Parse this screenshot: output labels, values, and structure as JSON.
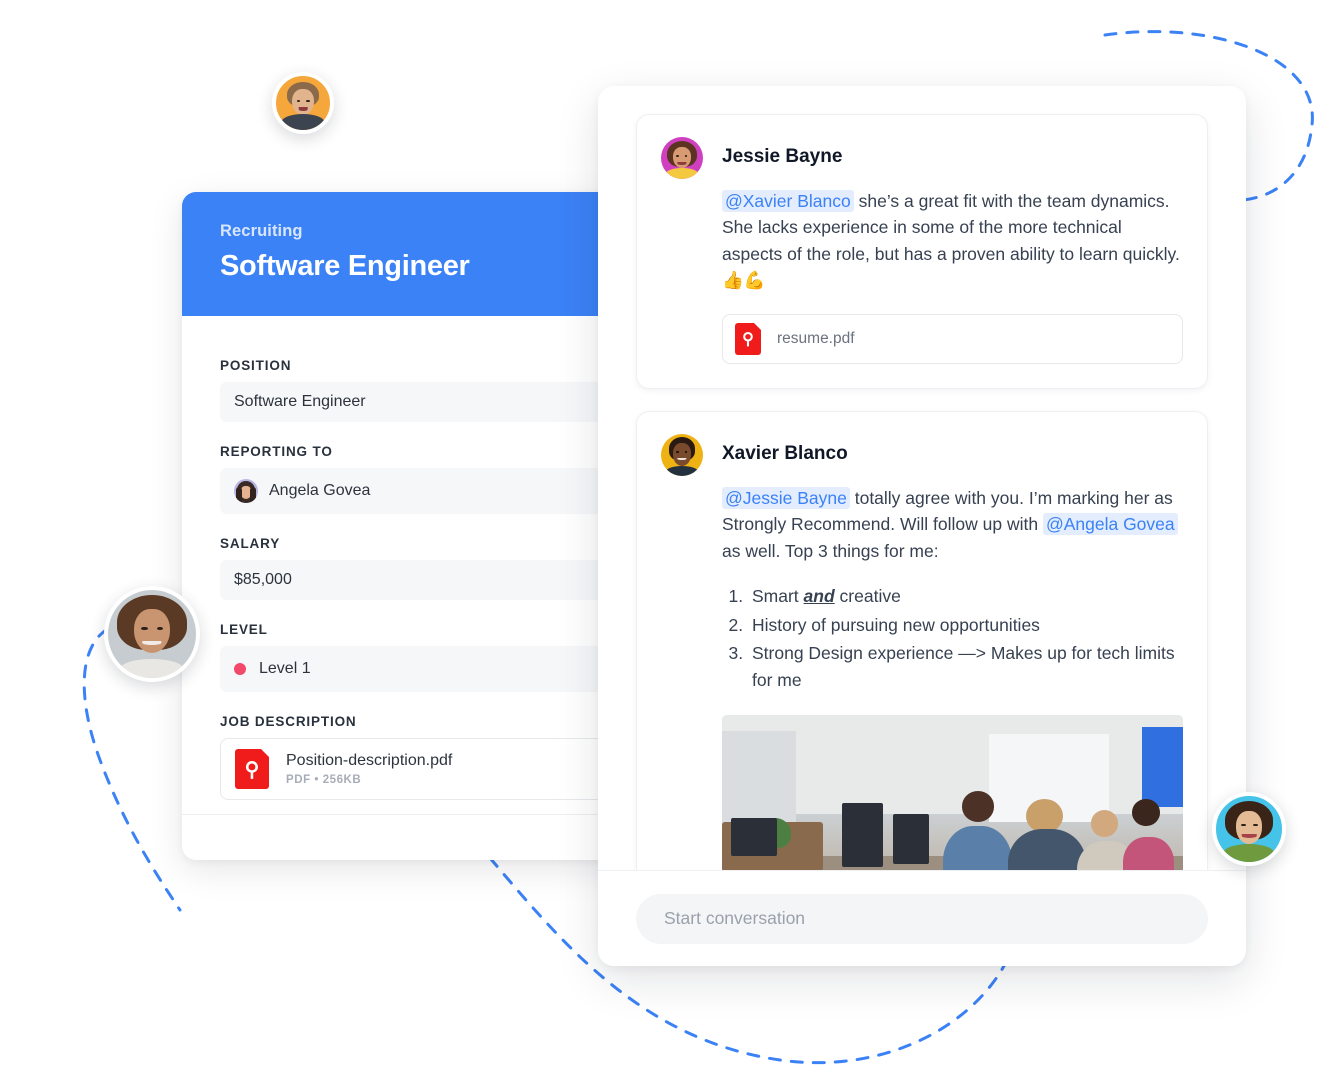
{
  "colors": {
    "brand_blue": "#3b82f6",
    "mention_blue": "#3b82f6",
    "mention_bg": "#e3edfd",
    "level_dot": "#f2486a",
    "pdf_red": "#f01c1c",
    "dashed_line": "#3b82f6"
  },
  "job_card": {
    "eyebrow": "Recruiting",
    "title": "Software Engineer",
    "fields": [
      {
        "label": "POSITION",
        "value": "Software Engineer",
        "type": "text"
      },
      {
        "label": "REPORTING TO",
        "value": "Angela Govea",
        "type": "person"
      },
      {
        "label": "SALARY",
        "value": "$85,000",
        "type": "text"
      },
      {
        "label": "LEVEL",
        "value": "Level 1",
        "type": "pill"
      }
    ],
    "attachment_label": "JOB DESCRIPTION",
    "attachment": {
      "name": "Position-description.pdf",
      "meta": "PDF • 256KB",
      "icon": "pdf-icon"
    }
  },
  "conversation": {
    "messages": [
      {
        "author": "Jessie Bayne",
        "avatar": "jessie-avatar",
        "text_parts": [
          {
            "type": "mention",
            "text": "@Xavier Blanco"
          },
          {
            "type": "plain",
            "text": " she’s a great fit with the team dynamics. She lacks experience in some of the more technical aspects of the role, but has a proven ability to learn quickly. 👍💪"
          }
        ],
        "attachment": {
          "name": "resume.pdf",
          "icon": "pdf-icon"
        }
      },
      {
        "author": "Xavier Blanco",
        "avatar": "xavier-avatar",
        "text_parts": [
          {
            "type": "mention",
            "text": "@Jessie Bayne"
          },
          {
            "type": "plain",
            "text": " totally agree with you. I’m marking her as Strongly Recommend. Will follow up with "
          },
          {
            "type": "mention",
            "text": "@Angela Govea"
          },
          {
            "type": "plain",
            "text": " as well. Top 3 things for me:"
          }
        ],
        "list": [
          {
            "pre": "Smart ",
            "emphasis": "and",
            "post": " creative"
          },
          {
            "pre": "History of pursuing new opportunities",
            "emphasis": "",
            "post": ""
          },
          {
            "pre": "Strong Design experience —> Makes up for tech limits for me",
            "emphasis": "",
            "post": ""
          }
        ],
        "photo": "office-team-photo"
      }
    ],
    "composer_placeholder": "Start conversation"
  },
  "floating_avatars": [
    {
      "name": "avatar-top-left",
      "bg": "#f5a73c"
    },
    {
      "name": "avatar-left-woman",
      "bg": "#c7ccd1"
    },
    {
      "name": "avatar-right-woman",
      "bg": "#45c3e8"
    }
  ]
}
